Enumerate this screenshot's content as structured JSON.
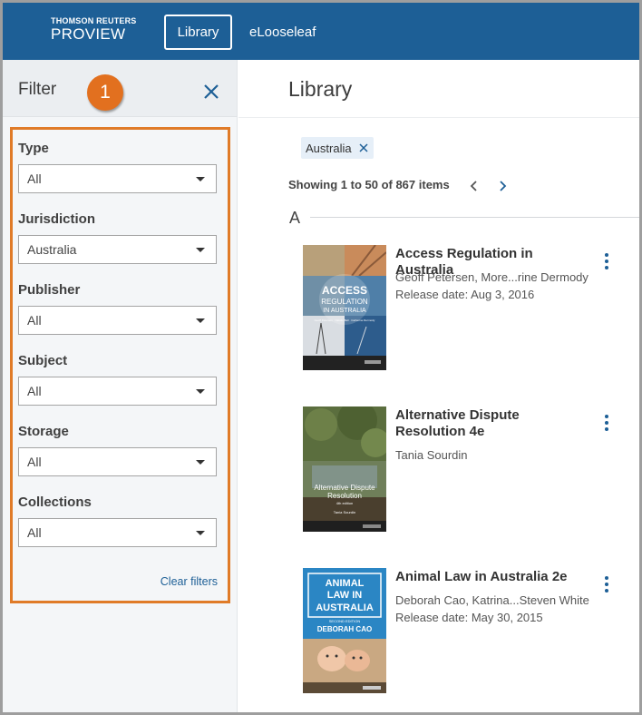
{
  "header": {
    "logo_line1": "THOMSON REUTERS",
    "logo_line2": "PROVIEW",
    "nav": [
      {
        "label": "Library",
        "active": true
      },
      {
        "label": "eLooseleaf",
        "active": false
      }
    ],
    "bg_color": "#1d5f96"
  },
  "sidebar": {
    "title": "Filter",
    "callout_number": "1",
    "callout_color": "#e2701f",
    "close_icon": "close-icon",
    "filters": [
      {
        "label": "Type",
        "value": "All"
      },
      {
        "label": "Jurisdiction",
        "value": "Australia"
      },
      {
        "label": "Publisher",
        "value": "All"
      },
      {
        "label": "Subject",
        "value": "All"
      },
      {
        "label": "Storage",
        "value": "All"
      },
      {
        "label": "Collections",
        "value": "All"
      }
    ],
    "clear_label": "Clear filters"
  },
  "main": {
    "title": "Library",
    "active_filter_chip": "Australia",
    "showing_text": "Showing 1 to 50 of 867 items",
    "section_letter": "A",
    "books": [
      {
        "title": "Access Regulation in Australia",
        "authors": "Geoff Petersen, More...rine Dermody",
        "release": "Release date: Aug 3, 2016",
        "cover_text_1": "ACCESS",
        "cover_text_2": "REGULATION",
        "cover_text_3": "IN AUSTRALIA",
        "cover_authors": "Geoff Petersen · Natalie Bell · Catherine Dermody"
      },
      {
        "title": "Alternative Dispute Resolution 4e",
        "authors": "Tania Sourdin",
        "release": "",
        "cover_text_1": "Alternative Dispute",
        "cover_text_2": "Resolution",
        "cover_text_3": "4th edition",
        "cover_authors": "Tania Sourdin"
      },
      {
        "title": "Animal Law in Australia 2e",
        "authors": "Deborah Cao, Katrina...Steven White",
        "release": "Release date: May 30, 2015",
        "cover_text_1": "ANIMAL",
        "cover_text_2": "LAW IN",
        "cover_text_3": "AUSTRALIA",
        "cover_edition": "SECOND EDITION",
        "cover_authors": "DEBORAH CAO"
      }
    ]
  }
}
